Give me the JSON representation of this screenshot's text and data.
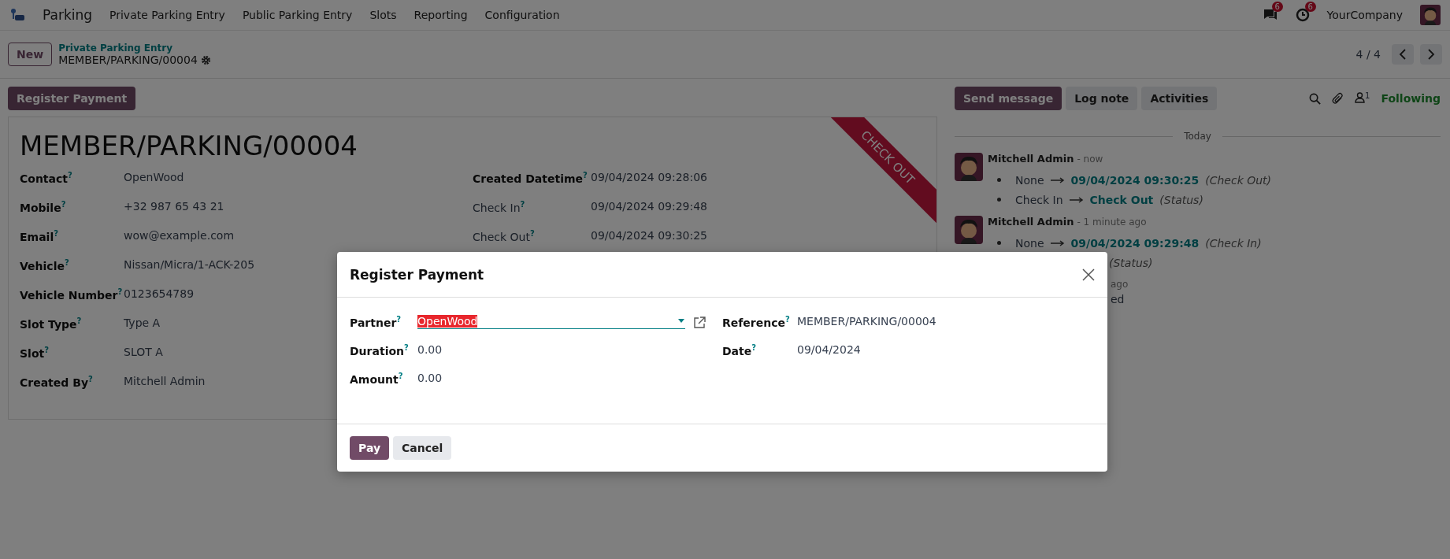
{
  "navbar": {
    "app_name": "Parking",
    "menu": [
      "Private Parking Entry",
      "Public Parking Entry",
      "Slots",
      "Reporting",
      "Configuration"
    ],
    "messages_badge": "6",
    "activities_badge": "6",
    "company": "YourCompany"
  },
  "control_panel": {
    "new_button": "New",
    "breadcrumb_parent": "Private Parking Entry",
    "record_name": "MEMBER/PARKING/00004",
    "pager": "4 / 4"
  },
  "actions": [
    "Register Payment"
  ],
  "form": {
    "title": "MEMBER/PARKING/00004",
    "ribbon": "CHECK OUT",
    "fields_left": [
      {
        "label": "Contact",
        "help": "?",
        "value": "OpenWood",
        "kind": "strong"
      },
      {
        "label": "Mobile",
        "help": "?",
        "value": "+32 987 65 43 21",
        "kind": "strong"
      },
      {
        "label": "Email",
        "help": "?",
        "value": "wow@example.com",
        "kind": "strong"
      },
      {
        "label": "Vehicle",
        "help": "?",
        "value": "Nissan/Micra/1-ACK-205",
        "kind": "strong"
      },
      {
        "label": "Vehicle Number",
        "help": "?",
        "value": "0123654789",
        "kind": "strong"
      },
      {
        "label": "Slot Type",
        "help": "?",
        "value": "Type A",
        "kind": "strong"
      },
      {
        "label": "Slot",
        "help": "?",
        "value": "SLOT A",
        "kind": "strong"
      },
      {
        "label": "Created By",
        "help": "?",
        "value": "Mitchell Admin",
        "kind": "strong"
      }
    ],
    "fields_right": [
      {
        "label": "Created Datetime",
        "help": "?",
        "value": "09/04/2024 09:28:06",
        "kind": "strong"
      },
      {
        "label": "Check In",
        "help": "?",
        "value": "09/04/2024 09:29:48",
        "kind": "plain"
      },
      {
        "label": "Check Out",
        "help": "?",
        "value": "09/04/2024 09:30:25",
        "kind": "plain"
      }
    ]
  },
  "chatter": {
    "buttons": [
      {
        "label": "Send message",
        "selected": true
      },
      {
        "label": "Log note",
        "selected": false
      },
      {
        "label": "Activities",
        "selected": false
      }
    ],
    "followers_count": "1",
    "following": "Following",
    "day": "Today",
    "messages": [
      {
        "kind": "full",
        "author": "Mitchell Admin",
        "time": "- now",
        "changes": [
          {
            "kind": "full",
            "old": "None",
            "new": "09/04/2024 09:30:25",
            "field": "(Check Out)"
          },
          {
            "kind": "full",
            "old": "Check In",
            "new": "Check Out",
            "field": "(Status)"
          }
        ]
      },
      {
        "kind": "full",
        "author": "Mitchell Admin",
        "time": "- 1 minute ago",
        "changes": [
          {
            "kind": "full",
            "old": "None",
            "new": "09/04/2024 09:29:48",
            "field": "(Check In)"
          },
          {
            "kind": "covered",
            "field": "(Status)"
          }
        ]
      },
      {
        "kind": "covered",
        "time": "ago",
        "body": "ed"
      }
    ]
  },
  "dialog": {
    "title": "Register Payment",
    "fields_left": [
      {
        "label": "Partner",
        "help": "?",
        "value": "OpenWood",
        "kind": "many2one"
      },
      {
        "label": "Duration",
        "help": "?",
        "value": "0.00",
        "kind": "text"
      },
      {
        "label": "Amount",
        "help": "?",
        "value": "0.00",
        "kind": "text"
      }
    ],
    "fields_right": [
      {
        "label": "Reference",
        "help": "?",
        "value": "MEMBER/PARKING/00004",
        "kind": "text"
      },
      {
        "label": "Date",
        "help": "?",
        "value": "09/04/2024",
        "kind": "text"
      }
    ],
    "buttons": [
      {
        "label": "Pay",
        "kind": "primary"
      },
      {
        "label": "Cancel",
        "kind": "secondary"
      }
    ]
  }
}
